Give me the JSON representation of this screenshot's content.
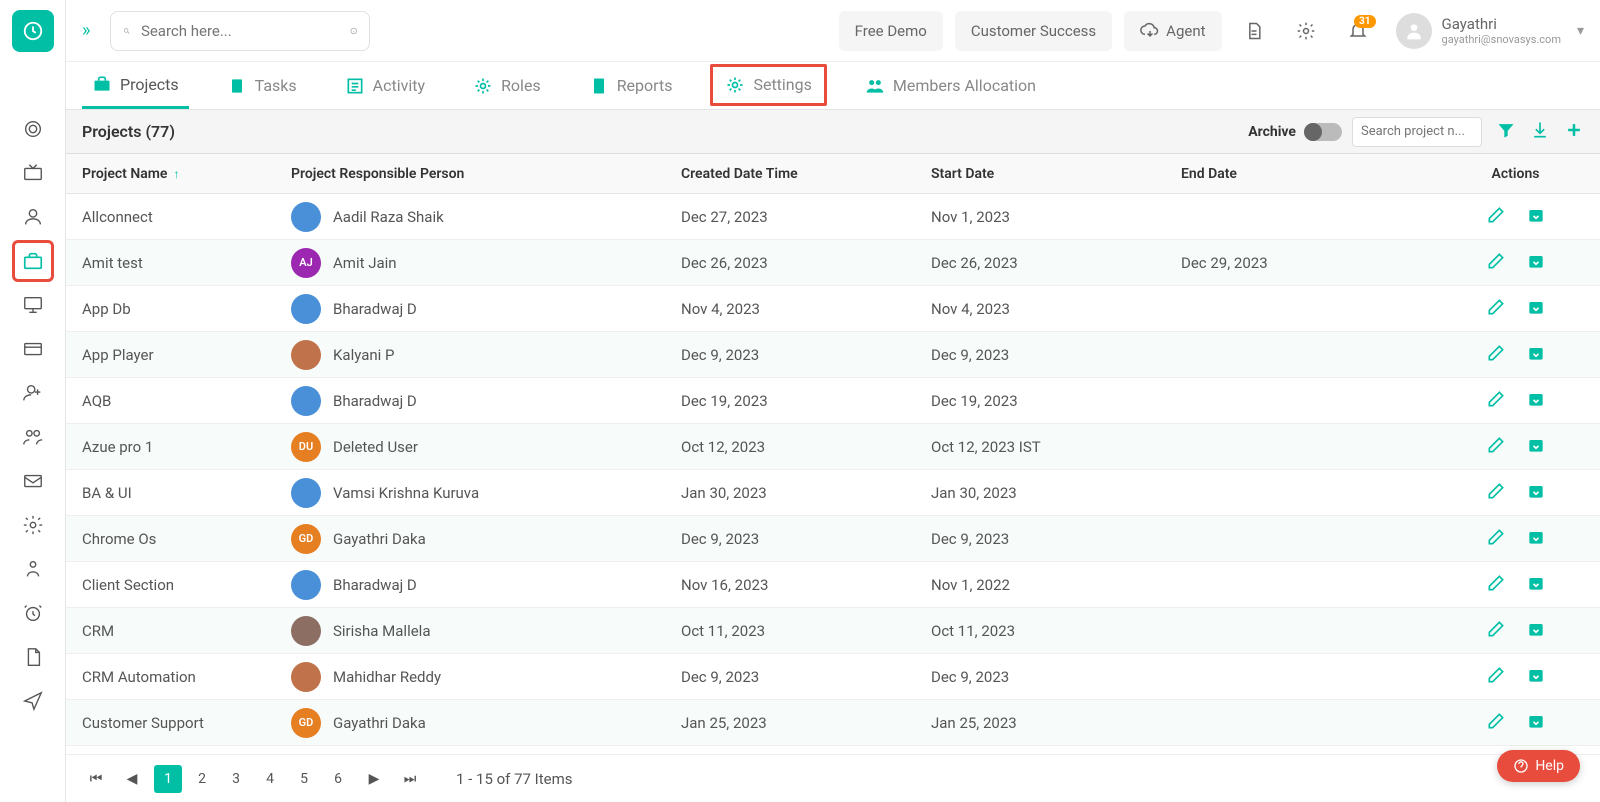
{
  "topbar": {
    "search_placeholder": "Search here...",
    "buttons": {
      "free_demo": "Free Demo",
      "customer_success": "Customer Success",
      "agent": "Agent"
    },
    "notification_badge": "31",
    "user": {
      "name": "Gayathri",
      "email": "gayathri@snovasys.com"
    }
  },
  "tabs": {
    "projects": "Projects",
    "tasks": "Tasks",
    "activity": "Activity",
    "roles": "Roles",
    "reports": "Reports",
    "settings": "Settings",
    "members_allocation": "Members Allocation"
  },
  "panel": {
    "title": "Projects  (77)",
    "archive_label": "Archive",
    "search_placeholder": "Search project n..."
  },
  "columns": {
    "name": "Project Name",
    "person": "Project Responsible Person",
    "created": "Created Date Time",
    "start": "Start Date",
    "end": "End Date",
    "actions": "Actions"
  },
  "rows": [
    {
      "name": "Allconnect",
      "person": "Aadil Raza Shaik",
      "avatar_bg": "#4a90d9",
      "avatar_txt": "",
      "created": "Dec 27, 2023",
      "start": "Nov 1, 2023",
      "end": ""
    },
    {
      "name": "Amit test",
      "person": "Amit Jain",
      "avatar_bg": "#9c27b0",
      "avatar_txt": "AJ",
      "created": "Dec 26, 2023",
      "start": "Dec 26, 2023",
      "end": "Dec 29, 2023"
    },
    {
      "name": "App Db",
      "person": "Bharadwaj D",
      "avatar_bg": "#4a90d9",
      "avatar_txt": "",
      "created": "Nov 4, 2023",
      "start": "Nov 4, 2023",
      "end": ""
    },
    {
      "name": "App Player",
      "person": "Kalyani P",
      "avatar_bg": "#c0734a",
      "avatar_txt": "",
      "created": "Dec 9, 2023",
      "start": "Dec 9, 2023",
      "end": ""
    },
    {
      "name": "AQB",
      "person": "Bharadwaj D",
      "avatar_bg": "#4a90d9",
      "avatar_txt": "",
      "created": "Dec 19, 2023",
      "start": "Dec 19, 2023",
      "end": ""
    },
    {
      "name": "Azue pro 1",
      "person": "Deleted User",
      "avatar_bg": "#e67e22",
      "avatar_txt": "DU",
      "created": "Oct 12, 2023",
      "start": "Oct 12, 2023 IST",
      "end": ""
    },
    {
      "name": "BA & UI",
      "person": "Vamsi Krishna Kuruva",
      "avatar_bg": "#4a90d9",
      "avatar_txt": "",
      "created": "Jan 30, 2023",
      "start": "Jan 30, 2023",
      "end": ""
    },
    {
      "name": "Chrome Os",
      "person": "Gayathri Daka",
      "avatar_bg": "#e67e22",
      "avatar_txt": "GD",
      "created": "Dec 9, 2023",
      "start": "Dec 9, 2023",
      "end": ""
    },
    {
      "name": "Client Section",
      "person": "Bharadwaj D",
      "avatar_bg": "#4a90d9",
      "avatar_txt": "",
      "created": "Nov 16, 2023",
      "start": "Nov 1, 2022",
      "end": ""
    },
    {
      "name": "CRM",
      "person": "Sirisha Mallela",
      "avatar_bg": "#8d6e63",
      "avatar_txt": "",
      "created": "Oct 11, 2023",
      "start": "Oct 11, 2023",
      "end": ""
    },
    {
      "name": "CRM Automation",
      "person": "Mahidhar Reddy",
      "avatar_bg": "#c0734a",
      "avatar_txt": "",
      "created": "Dec 9, 2023",
      "start": "Dec 9, 2023",
      "end": ""
    },
    {
      "name": "Customer Support",
      "person": "Gayathri Daka",
      "avatar_bg": "#e67e22",
      "avatar_txt": "GD",
      "created": "Jan 25, 2023",
      "start": "Jan 25, 2023",
      "end": ""
    }
  ],
  "pagination": {
    "pages": [
      "1",
      "2",
      "3",
      "4",
      "5",
      "6"
    ],
    "info": "1 - 15 of 77 Items"
  },
  "help": "Help"
}
